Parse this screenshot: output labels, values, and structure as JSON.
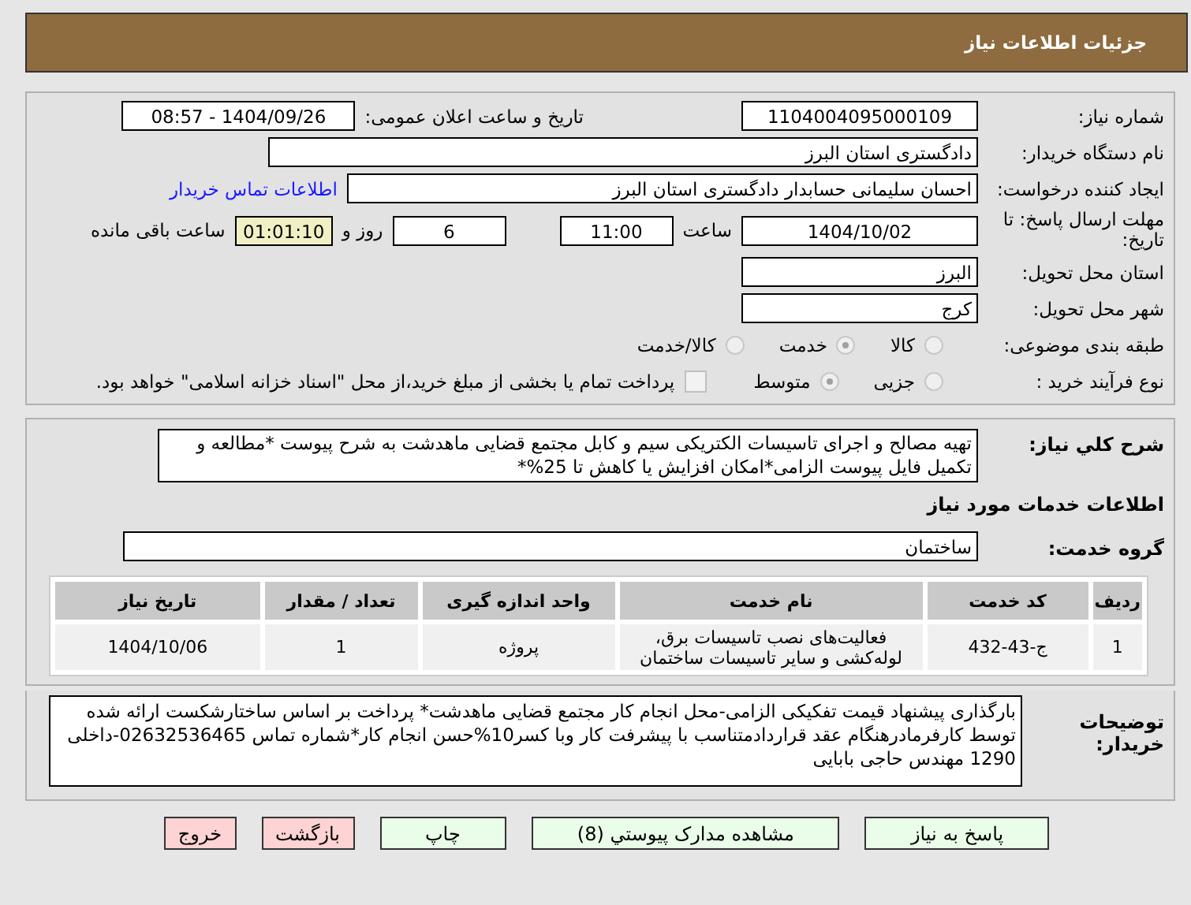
{
  "header": {
    "title": "جزئیات اطلاعات نیاز"
  },
  "need_number": {
    "label": "شماره نیاز:",
    "value": "1104004095000109"
  },
  "announce": {
    "label": "تاریخ و ساعت اعلان عمومی:",
    "value": "1404/09/26 - 08:57"
  },
  "buyer": {
    "label": "نام دستگاه خریدار:",
    "value": "دادگستری استان البرز"
  },
  "creator": {
    "label": "ایجاد کننده درخواست:",
    "value": "احسان سلیمانی حسابدار دادگستری استان البرز",
    "link": "اطلاعات تماس خریدار"
  },
  "deadline": {
    "label": "مهلت ارسال پاسخ: تا تاریخ:",
    "date": "1404/10/02",
    "time_label": "ساعت",
    "time": "11:00",
    "days": "6",
    "days_label": "روز و",
    "remaining": "01:01:10",
    "remaining_label": "ساعت باقی مانده"
  },
  "province": {
    "label": "استان محل تحویل:",
    "value": "البرز"
  },
  "city": {
    "label": "شهر محل تحویل:",
    "value": "کرج"
  },
  "category": {
    "label": "طبقه بندی موضوعی:",
    "options": [
      {
        "label": "کالا",
        "selected": false
      },
      {
        "label": "خدمت",
        "selected": true
      },
      {
        "label": "کالا/خدمت",
        "selected": false
      }
    ]
  },
  "process": {
    "label": "نوع فرآیند خرید :",
    "options": [
      {
        "label": "جزیی",
        "selected": false
      },
      {
        "label": "متوسط",
        "selected": true
      }
    ],
    "payment": {
      "checked": false,
      "label": "پرداخت تمام یا بخشی از مبلغ خرید،از محل \"اسناد خزانه اسلامی\" خواهد بود."
    }
  },
  "description": {
    "label": "شرح کلي نياز:",
    "value": "تهیه مصالح و اجرای تاسیسات الکتریکی سیم و کابل مجتمع قضایی ماهدشت به شرح پیوست *مطالعه و تکمیل فایل پیوست الزامی*امکان افزایش یا کاهش تا 25%*"
  },
  "services_title": "اطلاعات خدمات مورد نیاز",
  "service_group": {
    "label": "گروه خدمت:",
    "value": "ساختمان"
  },
  "table": {
    "columns": [
      "ردیف",
      "کد خدمت",
      "نام خدمت",
      "واحد اندازه گیری",
      "تعداد / مقدار",
      "تاریخ نیاز"
    ],
    "rows": [
      [
        "1",
        "ج-43-432",
        "فعالیت‌های نصب تاسیسات برق، لوله‌کشی و سایر تاسیسات ساختمان",
        "پروژه",
        "1",
        "1404/10/06"
      ]
    ]
  },
  "notes": {
    "label": "توضیحات خریدار:",
    "value": "بارگذاری پیشنهاد قیمت تفکیکی الزامی-محل انجام کار مجتمع قضایی ماهدشت* پرداخت بر اساس ساختارشکست ارائه شده توسط کارفرمادرهنگام عقد قراردادمتناسب با پیشرفت کار  وبا کسر10%حسن انجام کار*شماره تماس 02632536465-داخلی 1290 مهندس حاجی بابایی"
  },
  "buttons": [
    {
      "label": "پاسخ به نیاز",
      "kind": "action"
    },
    {
      "label": "مشاهده مدارک پیوستي (8)",
      "kind": "action"
    },
    {
      "label": "چاپ",
      "kind": "action"
    },
    {
      "label": "بازگشت",
      "kind": "danger"
    },
    {
      "label": "خروج",
      "kind": "danger"
    }
  ]
}
